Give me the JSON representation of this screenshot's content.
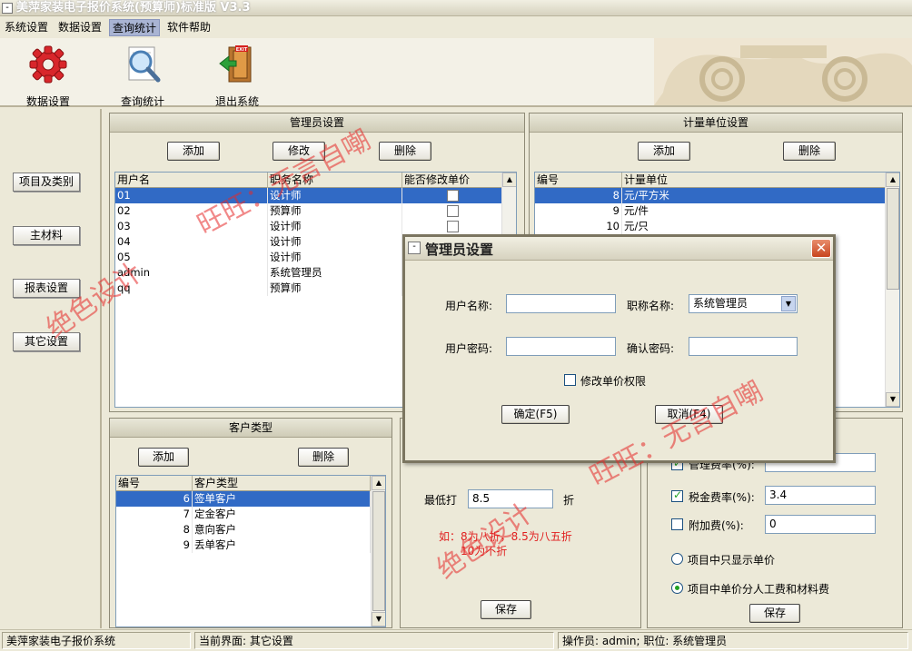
{
  "window": {
    "title": "美萍家装电子报价系统(预算师)标准版 V3.3",
    "sys_icon": "-"
  },
  "menu": [
    "系统设置",
    "数据设置",
    "查询统计",
    "软件帮助"
  ],
  "toolbar": {
    "items": [
      {
        "label": "数据设置",
        "icon": "gear-icon"
      },
      {
        "label": "查询统计",
        "icon": "magnifier-icon"
      },
      {
        "label": "退出系统",
        "icon": "exit-door-icon"
      }
    ],
    "exit_sign": "EXIT"
  },
  "left_nav": [
    "项目及类别",
    "主材料",
    "报表设置",
    "其它设置"
  ],
  "admin_panel": {
    "title": "管理员设置",
    "buttons": {
      "add": "添加",
      "edit": "修改",
      "delete": "删除"
    },
    "columns": [
      "用户名",
      "职务名称",
      "能否修改单价"
    ],
    "rows": [
      {
        "user": "01",
        "role": "设计师",
        "can_edit": false
      },
      {
        "user": "02",
        "role": "预算师",
        "can_edit": false
      },
      {
        "user": "03",
        "role": "设计师",
        "can_edit": false
      },
      {
        "user": "04",
        "role": "设计师",
        "can_edit": false
      },
      {
        "user": "05",
        "role": "设计师",
        "can_edit": false
      },
      {
        "user": "admin",
        "role": "系统管理员",
        "can_edit": false
      },
      {
        "user": "qq",
        "role": "预算师",
        "can_edit": false
      }
    ]
  },
  "unit_panel": {
    "title": "计量单位设置",
    "buttons": {
      "add": "添加",
      "delete": "删除"
    },
    "columns": [
      "编号",
      "计量单位"
    ],
    "rows": [
      {
        "id": "8",
        "unit": "元/平方米"
      },
      {
        "id": "9",
        "unit": "元/件"
      },
      {
        "id": "10",
        "unit": "元/只"
      }
    ]
  },
  "customer_panel": {
    "title": "客户类型",
    "buttons": {
      "add": "添加",
      "delete": "删除"
    },
    "columns": [
      "编号",
      "客户类型"
    ],
    "rows": [
      {
        "id": "6",
        "type": "签单客户"
      },
      {
        "id": "7",
        "type": "定金客户"
      },
      {
        "id": "8",
        "type": "意向客户"
      },
      {
        "id": "9",
        "type": "丢单客户"
      }
    ]
  },
  "discount": {
    "label": "最低打",
    "value": "8.5",
    "unit": "折",
    "hint_line1": "如：8为八折，8.5为八五折",
    "hint_line2": "10为不折",
    "save": "保存"
  },
  "fees": {
    "mgmt_label": "管理费率(%):",
    "mgmt_checked": true,
    "mgmt_value": "",
    "tax_label": "税金费率(%):",
    "tax_checked": true,
    "tax_value": "3.4",
    "extra_label": "附加费(%):",
    "extra_checked": false,
    "extra_value": "0",
    "radio1": "项目中只显示单价",
    "radio2": "项目中单价分人工费和材料费",
    "radio_selected": 2,
    "save": "保存"
  },
  "dialog": {
    "title": "管理员设置",
    "username_label": "用户名称:",
    "username_value": "",
    "role_label": "职称名称:",
    "role_value": "系统管理员",
    "password_label": "用户密码:",
    "confirm_label": "确认密码:",
    "perm_label": "修改单价权限",
    "ok": "确定(F5)",
    "cancel": "取消(F4)"
  },
  "watermarks": [
    "旺旺：无言自嘲",
    "绝色设计",
    "旺旺：无言自嘲",
    "绝色设计"
  ],
  "status": {
    "app": "美萍家装电子报价系统",
    "screen": "当前界面: 其它设置",
    "operator": "操作员: admin; 职位: 系统管理员"
  }
}
